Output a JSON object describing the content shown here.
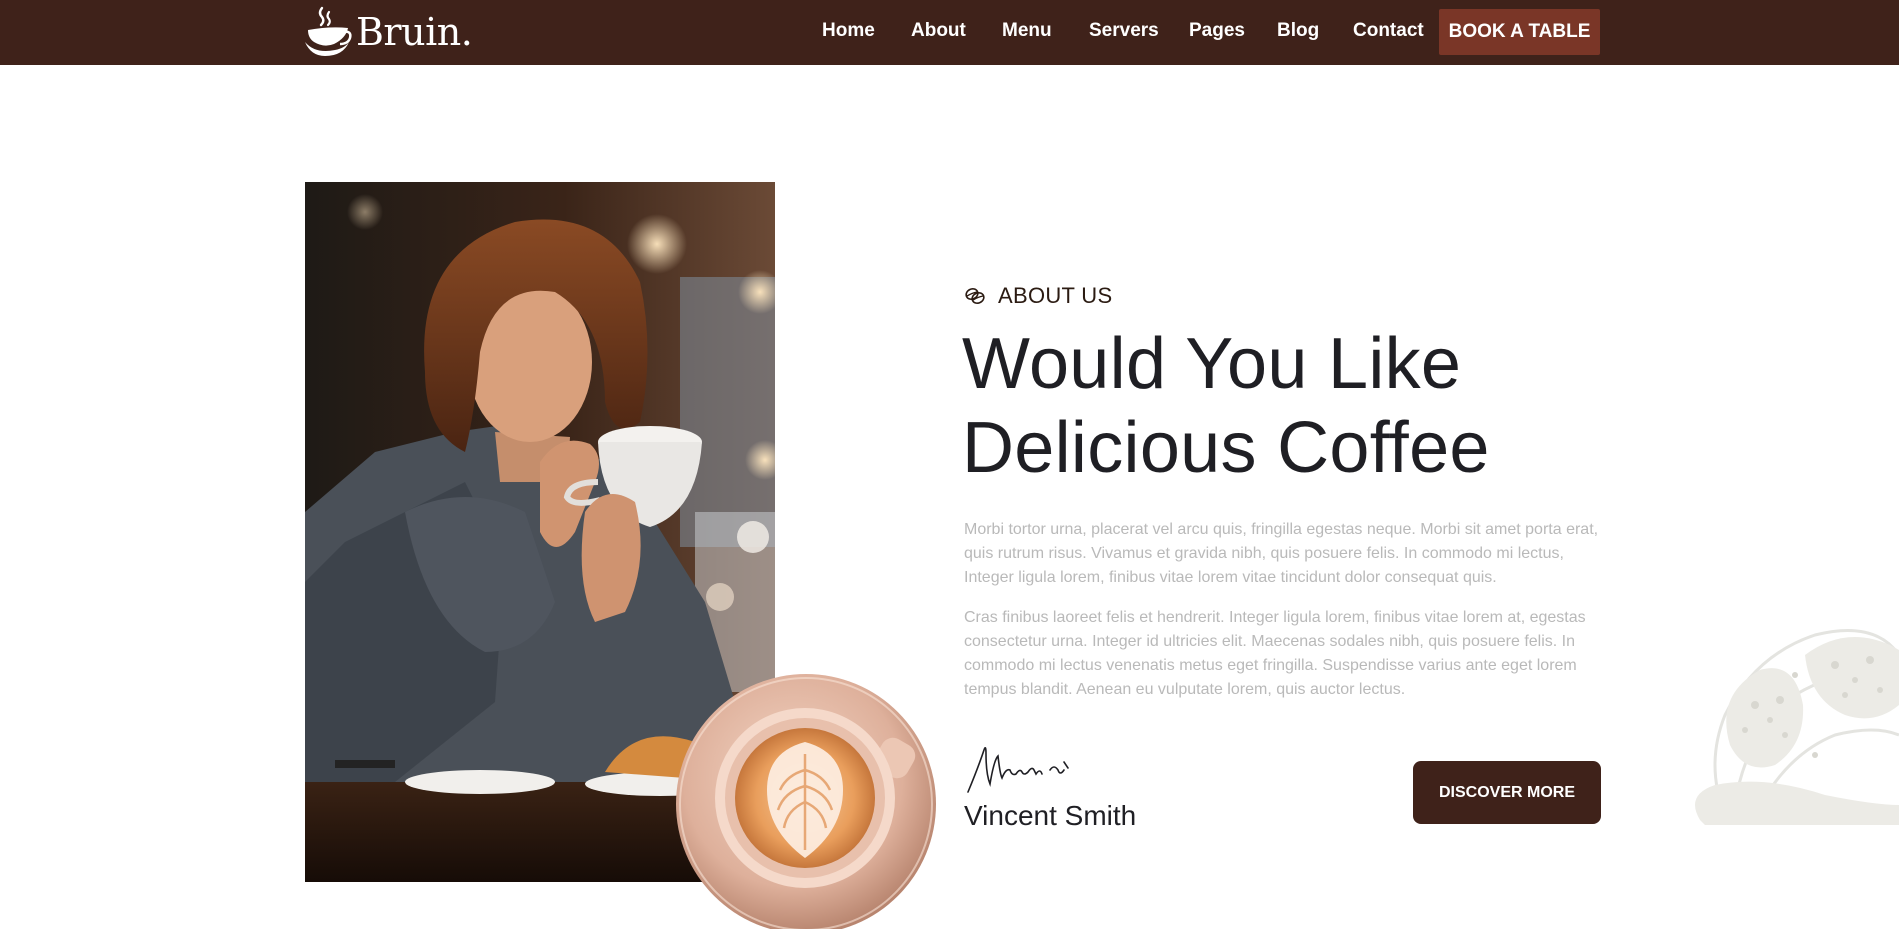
{
  "header": {
    "brand": "Bruin.",
    "nav": [
      {
        "label": "Home"
      },
      {
        "label": "About"
      },
      {
        "label": "Menu"
      },
      {
        "label": "Servers"
      },
      {
        "label": "Pages"
      },
      {
        "label": "Blog"
      },
      {
        "label": "Contact"
      }
    ],
    "cta_label": "BOOK A TABLE"
  },
  "about": {
    "tag": "ABOUT US",
    "heading_line1": "Would You Like",
    "heading_line2": "Delicious Coffee",
    "paragraph1": "Morbi tortor urna, placerat vel arcu quis, fringilla egestas neque. Morbi sit amet porta erat, quis rutrum risus. Vivamus et gravida nibh, quis posuere felis. In commodo mi lectus, Integer ligula lorem, finibus vitae lorem vitae tincidunt dolor consequat quis.",
    "paragraph2": "Cras finibus laoreet felis et hendrerit. Integer ligula lorem, finibus vitae lorem at, egestas consectetur urna. Integer id ultricies elit. Maecenas sodales nibh, quis posuere felis. In commodo mi lectus venenatis metus eget fringilla. Suspendisse varius ante eget lorem tempus blandit. Aenean eu vulputate lorem, quis auctor lectus.",
    "signer_name": "Vincent Smith",
    "button_label": "DISCOVER MORE"
  },
  "icons": {
    "logo": "coffee-cup-logo-icon",
    "tag": "coffee-bean-icon"
  },
  "colors": {
    "header_bg": "#3f221a",
    "cta_bg": "#7a3627",
    "button_bg": "#3f221a",
    "heading": "#1f1f24",
    "body_text": "#b9b9b9"
  }
}
